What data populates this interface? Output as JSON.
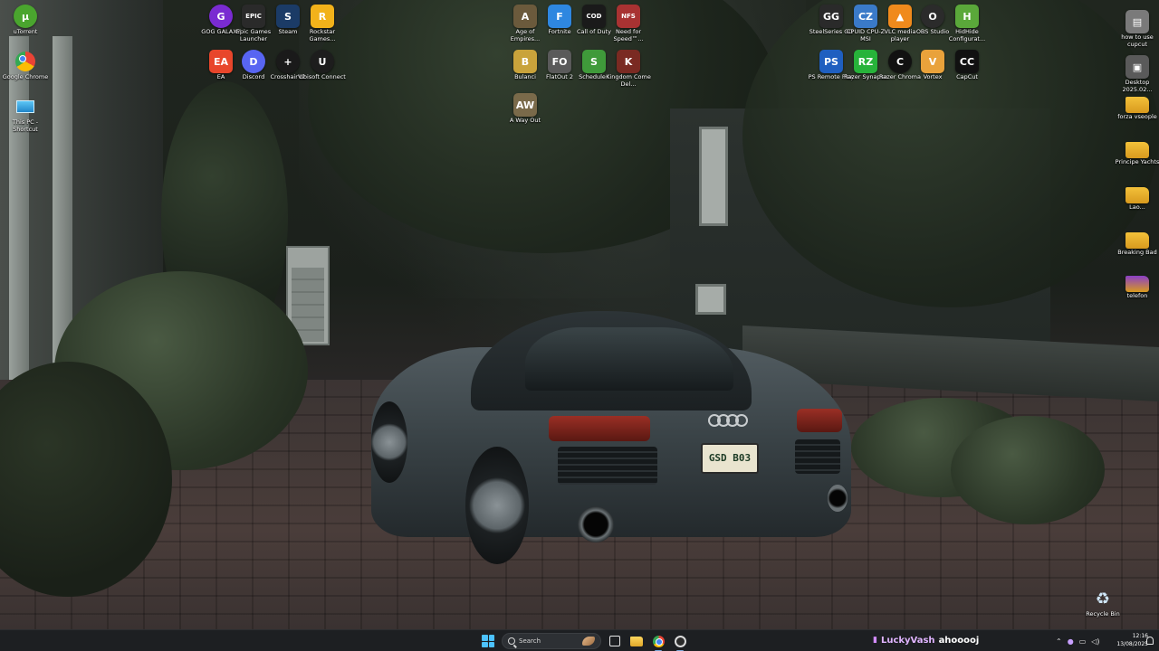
{
  "desktop": {
    "icons_left": [
      {
        "label": "uTorrent",
        "glyph": "µ",
        "color": "#4aa52e"
      },
      {
        "label": "Google Chrome",
        "glyph": "chrome",
        "color": "#ffffff"
      },
      {
        "label": "This PC - Shortcut",
        "glyph": "pc",
        "color": "#3aa6e0"
      }
    ],
    "icons_group1": [
      {
        "label": "GOG GALAXY",
        "glyph": "G",
        "color": "#7a2bd1"
      },
      {
        "label": "Epic Games Launcher",
        "glyph": "EPIC",
        "color": "#2a2a2a"
      },
      {
        "label": "Steam",
        "glyph": "S",
        "color": "#1b3b66"
      },
      {
        "label": "Rockstar Games...",
        "glyph": "R",
        "color": "#f2b21a"
      },
      {
        "label": "EA",
        "glyph": "EA",
        "color": "#e8462b"
      },
      {
        "label": "Discord",
        "glyph": "D",
        "color": "#5865f2"
      },
      {
        "label": "CrosshairV2",
        "glyph": "+",
        "color": "#1a1a1a"
      },
      {
        "label": "Ubisoft Connect",
        "glyph": "U",
        "color": "#1d1d1d"
      }
    ],
    "icons_group2": [
      {
        "label": "Age of Empires...",
        "glyph": "A",
        "color": "#6b5a3c"
      },
      {
        "label": "Fortnite",
        "glyph": "F",
        "color": "#2e87e0"
      },
      {
        "label": "Call of Duty",
        "glyph": "COD",
        "color": "#1a1a1a"
      },
      {
        "label": "Need for Speed™...",
        "glyph": "NFS",
        "color": "#a83232"
      },
      {
        "label": "Bulanci",
        "glyph": "B",
        "color": "#c9a33b"
      },
      {
        "label": "FlatOut 2",
        "glyph": "FO",
        "color": "#5a5a5a"
      },
      {
        "label": "Schedule I",
        "glyph": "S",
        "color": "#3f9a3a"
      },
      {
        "label": "Kingdom Come Del...",
        "glyph": "K",
        "color": "#7a2a22"
      },
      {
        "label": "A Way Out",
        "glyph": "AW",
        "color": "#7a6a4a"
      }
    ],
    "icons_group3": [
      {
        "label": "SteelSeries GG",
        "glyph": "GG",
        "color": "#2a2a2a"
      },
      {
        "label": "CPUID CPU-Z MSI",
        "glyph": "CZ",
        "color": "#3a7ac8"
      },
      {
        "label": "VLC media player",
        "glyph": "▲",
        "color": "#f08a1c"
      },
      {
        "label": "OBS Studio",
        "glyph": "O",
        "color": "#2b2b2b"
      },
      {
        "label": "HidHide Configurat...",
        "glyph": "H",
        "color": "#5aa83a"
      },
      {
        "label": "PS Remote Play",
        "glyph": "PS",
        "color": "#1f5fc0"
      },
      {
        "label": "Razer Synapse",
        "glyph": "RZ",
        "color": "#27b33a"
      },
      {
        "label": "Razer Chroma",
        "glyph": "C",
        "color": "#111111"
      },
      {
        "label": "Vortex",
        "glyph": "V",
        "color": "#e9a23b"
      },
      {
        "label": "CapCut",
        "glyph": "CC",
        "color": "#111111"
      }
    ],
    "icons_right": [
      {
        "label": "how to use cupcut",
        "glyph": "▤",
        "color": "#7a7a7a"
      },
      {
        "label": "Desktop 2025.02...",
        "glyph": "▣",
        "color": "#5a5a5a"
      },
      {
        "label": "forza vseople",
        "glyph": "",
        "color": "#f3c13a"
      },
      {
        "label": "Principe Yachts",
        "glyph": "",
        "color": "#f3c13a"
      },
      {
        "label": "Lao...",
        "glyph": "",
        "color": "#f3c13a"
      },
      {
        "label": "Breaking Bad",
        "glyph": "",
        "color": "#f3c13a"
      },
      {
        "label": "telefon",
        "glyph": "",
        "color": "#8a3fc8"
      }
    ],
    "recycle_bin": {
      "label": "Recycle Bin",
      "glyph": "♻",
      "color": "#b8d8f0"
    },
    "plate_text": "GSD B03"
  },
  "taskbar": {
    "search_placeholder": "Search",
    "overlay_user": "LuckyVash",
    "overlay_message": "ahooooj",
    "clock_time": "12:16",
    "clock_date": "13/08/2025",
    "accent": "#4cc2ff"
  }
}
